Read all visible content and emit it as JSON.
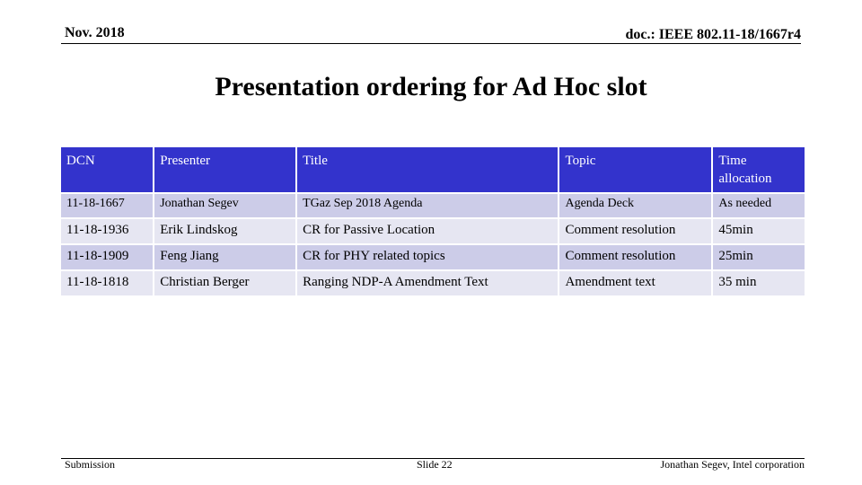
{
  "header": {
    "date": "Nov. 2018",
    "doc_id": "doc.: IEEE 802.11-18/1667r4"
  },
  "slide_title": "Presentation ordering for Ad Hoc slot",
  "table": {
    "columns": [
      "DCN",
      "Presenter",
      "Title",
      "Topic",
      "Time allocation"
    ],
    "rows": [
      [
        "11-18-1667",
        "Jonathan Segev",
        "TGaz Sep 2018 Agenda",
        "Agenda Deck",
        "As needed"
      ],
      [
        "11-18-1936",
        "Erik Lindskog",
        "CR for Passive Location",
        "Comment resolution",
        "45min"
      ],
      [
        "11-18-1909",
        "Feng Jiang",
        "CR for PHY related topics",
        "Comment resolution",
        "25min"
      ],
      [
        "11-18-1818",
        "Christian Berger",
        "Ranging NDP-A Amendment Text",
        "Amendment text",
        "35 min"
      ]
    ]
  },
  "colors": {
    "header_fill": "#3333cc",
    "row_odd": "#cccce8",
    "row_even": "#e6e6f2"
  },
  "footer": {
    "left": "Submission",
    "center": "Slide 22",
    "right": "Jonathan Segev, Intel corporation"
  }
}
